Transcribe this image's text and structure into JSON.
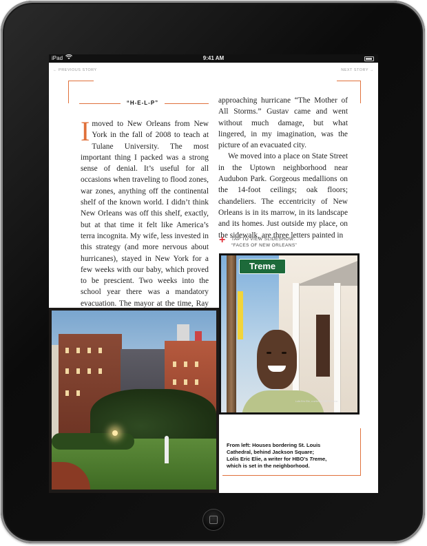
{
  "status_bar": {
    "carrier": "iPad",
    "time": "9:41 AM"
  },
  "nav": {
    "previous": "← PREVIOUS STORY",
    "next": "NEXT STORY →"
  },
  "section": {
    "label": "“H-E-L-P”"
  },
  "article": {
    "col1": {
      "dropcap": "I",
      "text": "moved to New Orleans from New York in the fall of 2008 to teach at Tulane University. The most important thing I packed was a strong sense of denial. It’s useful for all occasions when traveling to flood zones, war zones, anything off the continental shelf of the known world. I didn’t think New Orleans was off this shelf, exactly, but at that time it felt like America’s terra incognita. My wife, less invested in this strategy (and more nervous about hurricanes), stayed in New York for a few weeks with our baby, which proved to be prescient. Two weeks into the school year there was a mandatory evacuation. The mayor at the time, Ray Nagin, called the"
    },
    "col2": {
      "p1": "approaching hurricane “The Mother of All Storms.” Gustav came and went without much damage, but what lingered, in my imagination, was the picture of an evacuated city.",
      "p2": "We moved into a place on State Street in the Uptown neighborhood near Audubon Park. Gorgeous medallions on the 14-foot ceilings; oak floors; chandeliers. The eccentricity of New Orleans is in its marrow, in its landscape and its homes. Just outside my place, on the sidewalk, are three letters painted in"
    }
  },
  "slideshow": {
    "plus": "+",
    "line1": "TAP TO VIEW SLIDESHOW:",
    "line2": "“FACES OF NEW ORLEANS”"
  },
  "photo_right": {
    "sign_text": "Treme",
    "credit": "Lolis Eric Elie, a writer for HBO's Treme."
  },
  "caption": {
    "line1": "From left: Houses bordering St. Louis",
    "line2": "Cathedral, behind Jackson Square;",
    "line3a": "Lolis Eric Elie, a writer for HBO’s ",
    "line3b": "Treme",
    "line3c": ",",
    "line4": "which is set in the neighborhood."
  },
  "colors": {
    "accent": "#e0703a",
    "plus": "#e0303a",
    "bezel": "#111111"
  },
  "icons": {
    "wifi": "wifi-icon",
    "battery": "battery-icon",
    "home": "home-button-icon"
  }
}
